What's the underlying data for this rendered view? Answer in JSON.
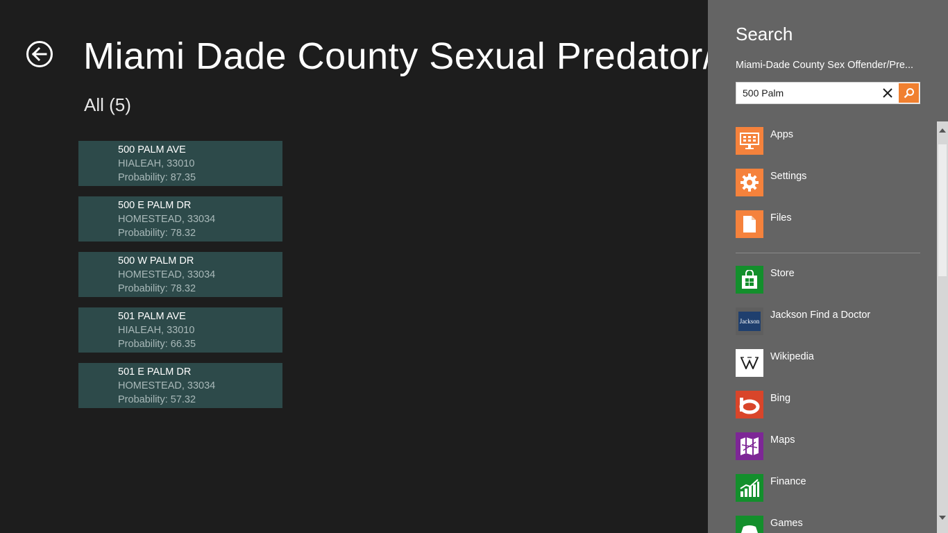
{
  "page": {
    "title": "Miami Dade County Sexual Predator/C",
    "group_header": "All (5)"
  },
  "results": [
    {
      "address": "500 PALM AVE",
      "city": "HIALEAH, 33010",
      "probability": "Probability: 87.35"
    },
    {
      "address": "500 E PALM DR",
      "city": "HOMESTEAD, 33034",
      "probability": "Probability: 78.32"
    },
    {
      "address": "500 W PALM DR",
      "city": "HOMESTEAD, 33034",
      "probability": "Probability: 78.32"
    },
    {
      "address": "501 PALM AVE",
      "city": "HIALEAH, 33010",
      "probability": "Probability: 66.35"
    },
    {
      "address": "501 E PALM DR",
      "city": "HOMESTEAD, 33034",
      "probability": "Probability: 57.32"
    }
  ],
  "search_charm": {
    "title": "Search",
    "scope": "Miami-Dade County Sex Offender/Pre...",
    "query": "500 Palm",
    "system_items": [
      {
        "label": "Apps",
        "icon": "apps-icon",
        "color": "#f5823c"
      },
      {
        "label": "Settings",
        "icon": "gear-icon",
        "color": "#f5823c"
      },
      {
        "label": "Files",
        "icon": "file-icon",
        "color": "#f5823c"
      }
    ],
    "app_items": [
      {
        "label": "Store",
        "icon": "store-icon",
        "color": "#138f2c"
      },
      {
        "label": "Jackson Find a Doctor",
        "icon": "jackson-logo-icon",
        "color": "#1f3f6e"
      },
      {
        "label": "Wikipedia",
        "icon": "wikipedia-icon",
        "color": "#ffffff"
      },
      {
        "label": "Bing",
        "icon": "bing-icon",
        "color": "#d9452a"
      },
      {
        "label": "Maps",
        "icon": "maps-icon",
        "color": "#7d2796"
      },
      {
        "label": "Finance",
        "icon": "finance-icon",
        "color": "#138f2c"
      },
      {
        "label": "Games",
        "icon": "games-icon",
        "color": "#138f2c"
      }
    ],
    "jackson_logo_text": "Jackson"
  }
}
